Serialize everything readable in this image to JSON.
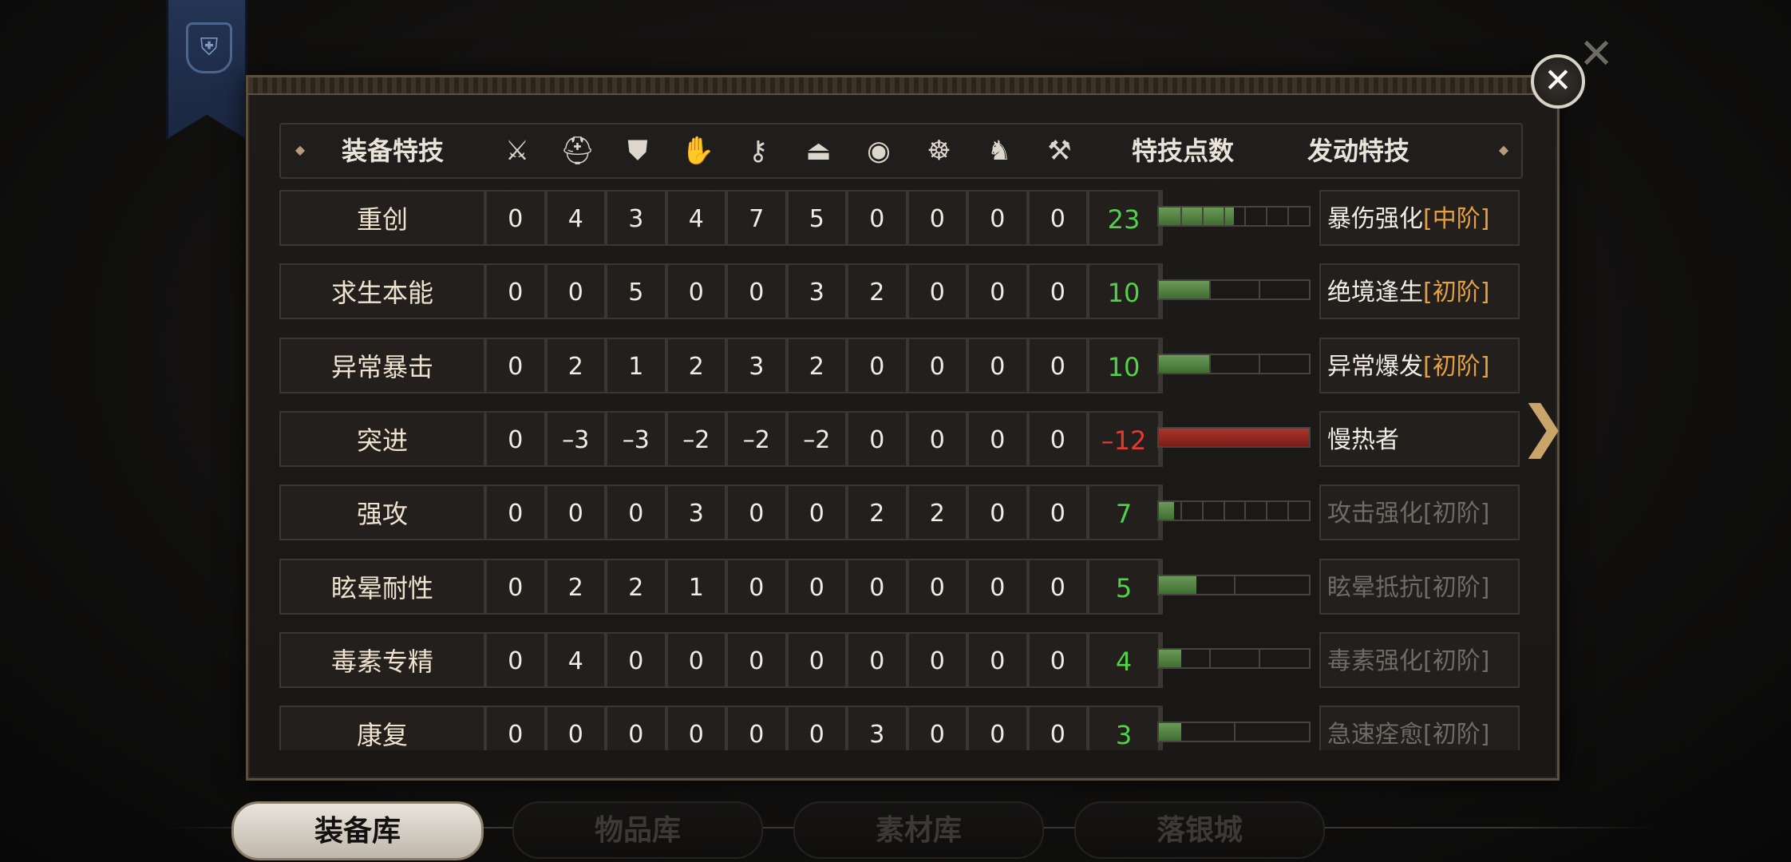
{
  "header": {
    "col_skill": "装备特技",
    "col_points": "特技点数",
    "col_active": "发动特技",
    "slot_icons": [
      "weapon-icon",
      "helmet-icon",
      "chest-armor-icon",
      "arm-armor-icon",
      "waist-armor-icon",
      "leg-armor-icon",
      "charm-icon",
      "pet-icon",
      "horse-icon",
      "tool-icon"
    ]
  },
  "colors": {
    "positive": "#52d24b",
    "negative": "#e23a32",
    "tier": "#e6a042",
    "inactive": "#6f6b66"
  },
  "rows": [
    {
      "name": "重创",
      "values": [
        "0",
        "4",
        "3",
        "4",
        "7",
        "5",
        "0",
        "0",
        "0",
        "0"
      ],
      "points": "23",
      "fill": 0.5,
      "segments": 7,
      "sign": "pos",
      "skill": "暴伤强化",
      "tier": "[中阶]",
      "active": true
    },
    {
      "name": "求生本能",
      "values": [
        "0",
        "0",
        "5",
        "0",
        "0",
        "3",
        "2",
        "0",
        "0",
        "0"
      ],
      "points": "10",
      "fill": 0.333,
      "segments": 3,
      "sign": "pos",
      "skill": "绝境逢生",
      "tier": "[初阶]",
      "active": true
    },
    {
      "name": "异常暴击",
      "values": [
        "0",
        "2",
        "1",
        "2",
        "3",
        "2",
        "0",
        "0",
        "0",
        "0"
      ],
      "points": "10",
      "fill": 0.333,
      "segments": 3,
      "sign": "pos",
      "skill": "异常爆发",
      "tier": "[初阶]",
      "active": true
    },
    {
      "name": "突进",
      "values": [
        "0",
        "–3",
        "–3",
        "–2",
        "–2",
        "–2",
        "0",
        "0",
        "0",
        "0"
      ],
      "points": "–12",
      "fill": 1.0,
      "segments": 1,
      "sign": "neg",
      "skill": "慢热者",
      "tier": "",
      "active": true
    },
    {
      "name": "强攻",
      "values": [
        "0",
        "0",
        "0",
        "3",
        "0",
        "0",
        "2",
        "2",
        "0",
        "0"
      ],
      "points": "7",
      "fill": 0.1,
      "segments": 7,
      "sign": "pos",
      "skill": "攻击强化",
      "tier": "[初阶]",
      "active": false
    },
    {
      "name": "眩晕耐性",
      "values": [
        "0",
        "2",
        "2",
        "1",
        "0",
        "0",
        "0",
        "0",
        "0",
        "0"
      ],
      "points": "5",
      "fill": 0.25,
      "segments": 2,
      "sign": "pos",
      "skill": "眩晕抵抗",
      "tier": "[初阶]",
      "active": false
    },
    {
      "name": "毒素专精",
      "values": [
        "0",
        "4",
        "0",
        "0",
        "0",
        "0",
        "0",
        "0",
        "0",
        "0"
      ],
      "points": "4",
      "fill": 0.15,
      "segments": 3,
      "sign": "pos",
      "skill": "毒素强化",
      "tier": "[初阶]",
      "active": false
    },
    {
      "name": "康复",
      "values": [
        "0",
        "0",
        "0",
        "0",
        "0",
        "0",
        "3",
        "0",
        "0",
        "0"
      ],
      "points": "3",
      "fill": 0.15,
      "segments": 2,
      "sign": "pos",
      "skill": "急速痊愈",
      "tier": "[初阶]",
      "active": false
    }
  ],
  "tabs": [
    {
      "label": "装备库",
      "active": true
    },
    {
      "label": "物品库",
      "active": false
    },
    {
      "label": "素材库",
      "active": false
    },
    {
      "label": "落银城",
      "active": false
    }
  ]
}
